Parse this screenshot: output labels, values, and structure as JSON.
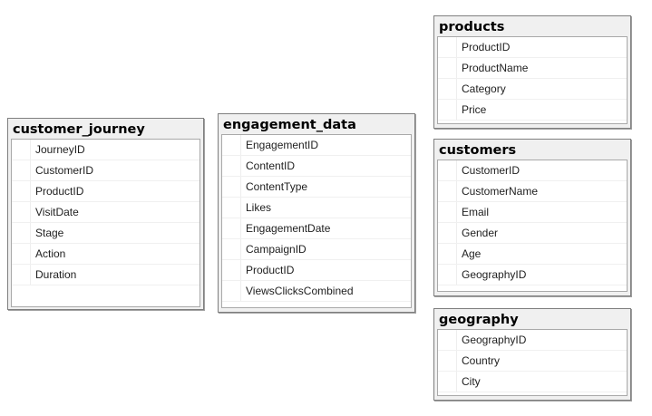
{
  "tables": {
    "customer_journey": {
      "name": "customer_journey",
      "columns": [
        "JourneyID",
        "CustomerID",
        "ProductID",
        "VisitDate",
        "Stage",
        "Action",
        "Duration"
      ]
    },
    "engagement_data": {
      "name": "engagement_data",
      "columns": [
        "EngagementID",
        "ContentID",
        "ContentType",
        "Likes",
        "EngagementDate",
        "CampaignID",
        "ProductID",
        "ViewsClicksCombined"
      ]
    },
    "products": {
      "name": "products",
      "columns": [
        "ProductID",
        "ProductName",
        "Category",
        "Price"
      ]
    },
    "customers": {
      "name": "customers",
      "columns": [
        "CustomerID",
        "CustomerName",
        "Email",
        "Gender",
        "Age",
        "GeographyID"
      ]
    },
    "geography": {
      "name": "geography",
      "columns": [
        "GeographyID",
        "Country",
        "City"
      ]
    }
  }
}
